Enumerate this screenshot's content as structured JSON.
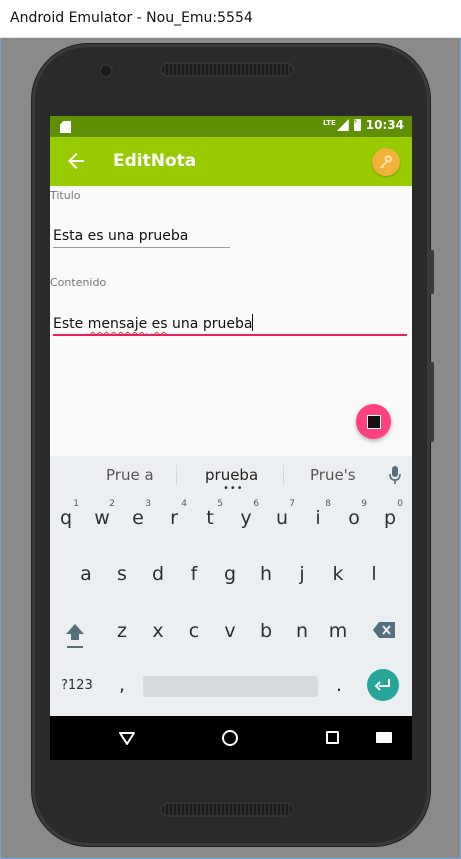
{
  "window": {
    "title": "Android Emulator - Nou_Emu:5554"
  },
  "status_bar": {
    "network": "LTE",
    "time": "10:34"
  },
  "app_bar": {
    "title": "EditNota",
    "back_icon": "arrow-left-icon",
    "action_icon": "key-icon"
  },
  "form": {
    "titulo_label": "Titulo",
    "titulo_value": "Esta es una prueba",
    "contenido_label": "Contenido",
    "contenido_parts": [
      "Este ",
      "mensaje",
      " ",
      "es",
      " una ",
      "prueba"
    ]
  },
  "fab": {
    "icon": "stop-icon"
  },
  "keyboard": {
    "suggestions": [
      "Prue a",
      "prueba",
      "Prue's"
    ],
    "row1": [
      {
        "key": "q",
        "hint": "1"
      },
      {
        "key": "w",
        "hint": "2"
      },
      {
        "key": "e",
        "hint": "3"
      },
      {
        "key": "r",
        "hint": "4"
      },
      {
        "key": "t",
        "hint": "5"
      },
      {
        "key": "y",
        "hint": "6"
      },
      {
        "key": "u",
        "hint": "7"
      },
      {
        "key": "i",
        "hint": "8"
      },
      {
        "key": "o",
        "hint": "9"
      },
      {
        "key": "p",
        "hint": "0"
      }
    ],
    "row2": [
      "a",
      "s",
      "d",
      "f",
      "g",
      "h",
      "j",
      "k",
      "l"
    ],
    "row3": [
      "z",
      "x",
      "c",
      "v",
      "b",
      "n",
      "m"
    ],
    "symbols_key": "?123",
    "comma_key": ",",
    "period_key": "."
  },
  "colors": {
    "app_bar": "#99cc00",
    "status_bar": "#5f8f05",
    "accent": "#ff4081",
    "enter_key": "#26a69a"
  }
}
